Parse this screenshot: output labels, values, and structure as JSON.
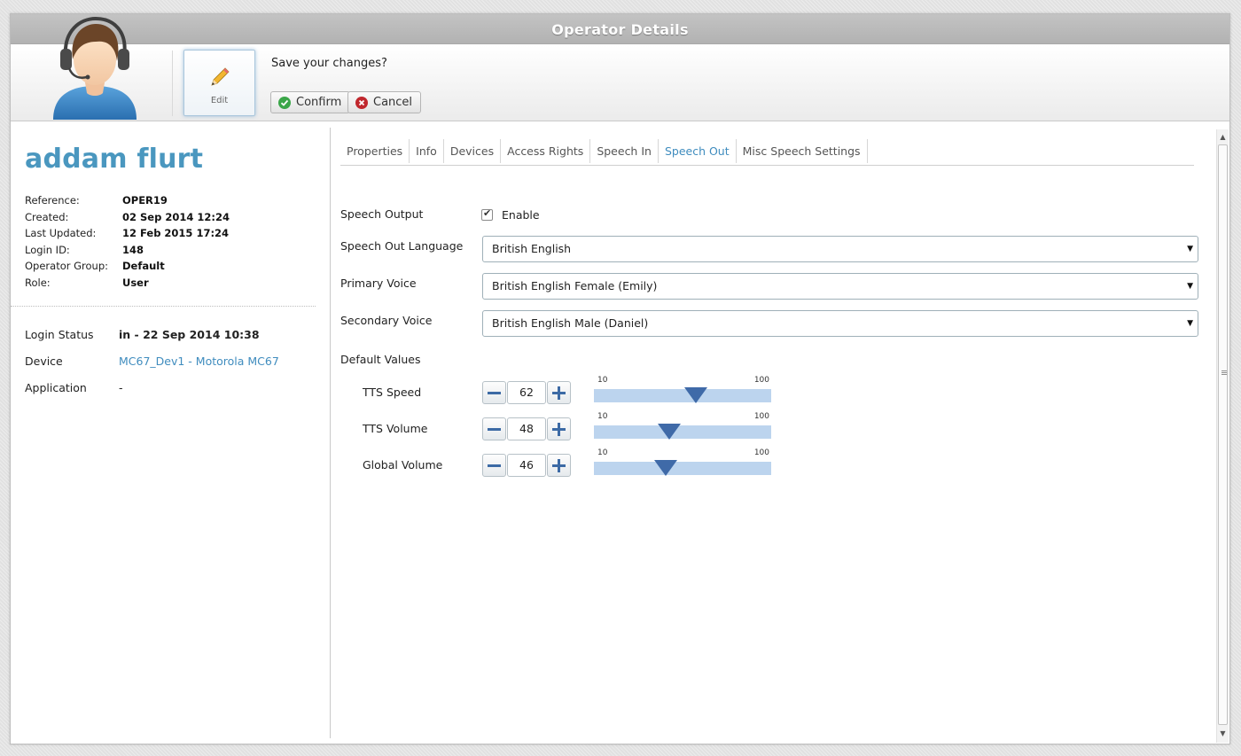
{
  "window": {
    "title": "Operator Details"
  },
  "toolbar": {
    "edit_label": "Edit",
    "save_prompt": "Save your changes?",
    "confirm_label": "Confirm",
    "cancel_label": "Cancel"
  },
  "operator": {
    "name": "addam flurt",
    "details": [
      {
        "label": "Reference:",
        "value": "OPER19"
      },
      {
        "label": "Created:",
        "value": "02 Sep 2014 12:24"
      },
      {
        "label": "Last Updated:",
        "value": "12 Feb 2015 17:24"
      },
      {
        "label": "Login ID:",
        "value": "148"
      },
      {
        "label": "Operator Group:",
        "value": "Default"
      },
      {
        "label": "Role:",
        "value": "User"
      }
    ],
    "status": [
      {
        "label": "Login Status",
        "value": "in - 22 Sep 2014 10:38"
      },
      {
        "label": "Device",
        "value": "MC67_Dev1 - Motorola MC67"
      },
      {
        "label": "Application",
        "value": "-"
      }
    ]
  },
  "tabs": [
    {
      "label": "Properties",
      "active": false
    },
    {
      "label": "Info",
      "active": false
    },
    {
      "label": "Devices",
      "active": false
    },
    {
      "label": "Access Rights",
      "active": false
    },
    {
      "label": "Speech In",
      "active": false
    },
    {
      "label": "Speech Out",
      "active": true
    },
    {
      "label": "Misc Speech Settings",
      "active": false
    }
  ],
  "speech_out": {
    "speech_output_label": "Speech Output",
    "enable_label": "Enable",
    "enabled": true,
    "language_label": "Speech Out Language",
    "language_value": "British English",
    "primary_voice_label": "Primary Voice",
    "primary_voice_value": "British English Female (Emily)",
    "secondary_voice_label": "Secondary Voice",
    "secondary_voice_value": "British English Male (Daniel)",
    "default_values_label": "Default Values",
    "values": [
      {
        "label": "TTS Speed",
        "value": 62,
        "min": 10,
        "max": 100
      },
      {
        "label": "TTS Volume",
        "value": 48,
        "min": 10,
        "max": 100
      },
      {
        "label": "Global Volume",
        "value": 46,
        "min": 10,
        "max": 100
      }
    ]
  },
  "colors": {
    "accent": "#4a97bf",
    "slider_track": "#bcd4ee",
    "slider_thumb": "#3f6aa8",
    "confirm_icon": "#3aa648",
    "cancel_icon": "#c0272d"
  },
  "icons": {
    "avatar": "operator-headset-avatar-icon",
    "edit": "pencil-icon",
    "confirm": "check-circle-icon",
    "cancel": "x-circle-icon"
  }
}
